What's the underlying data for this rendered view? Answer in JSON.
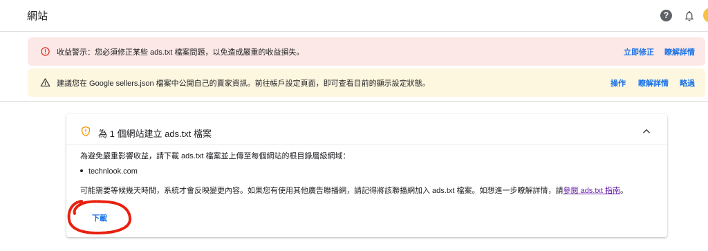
{
  "header": {
    "title": "網站",
    "help_glyph": "?"
  },
  "alerts": {
    "revenue": {
      "message": "收益警示：您必須修正某些 ads.txt 檔案問題，以免造成嚴重的收益損失。",
      "fix_now": "立即修正",
      "learn_more": "瞭解詳情",
      "color": "#fce8e6"
    },
    "sellers": {
      "message": "建議您在 Google sellers.json 檔案中公開自己的賣家資訊。前往帳戶設定頁面，即可查看目前的顯示設定狀態。",
      "action": "操作",
      "learn_more": "瞭解詳情",
      "dismiss": "略過",
      "color": "#fef7e0"
    }
  },
  "card": {
    "title": "為 1 個網站建立 ads.txt 檔案",
    "description": "為避免嚴重影響收益，請下載 ads.txt 檔案並上傳至每個網站的根目錄層級網域：",
    "sites": [
      "technlook.com"
    ],
    "note_prefix": "可能需要等候幾天時間，系統才會反映變更內容。如果您有使用其他廣告聯播網，請記得將該聯播網加入 ads.txt 檔案。如想進一步瞭解詳情，請",
    "note_link": "參閱 ads.txt 指南",
    "note_suffix": "。",
    "download": "下載"
  },
  "colors": {
    "accent": "#1a73e8",
    "link_visited": "#681da8",
    "error_icon": "#d93025",
    "warning_icon": "#5f6368",
    "shield": "#f29900",
    "highlight_circle": "#e8210f"
  }
}
